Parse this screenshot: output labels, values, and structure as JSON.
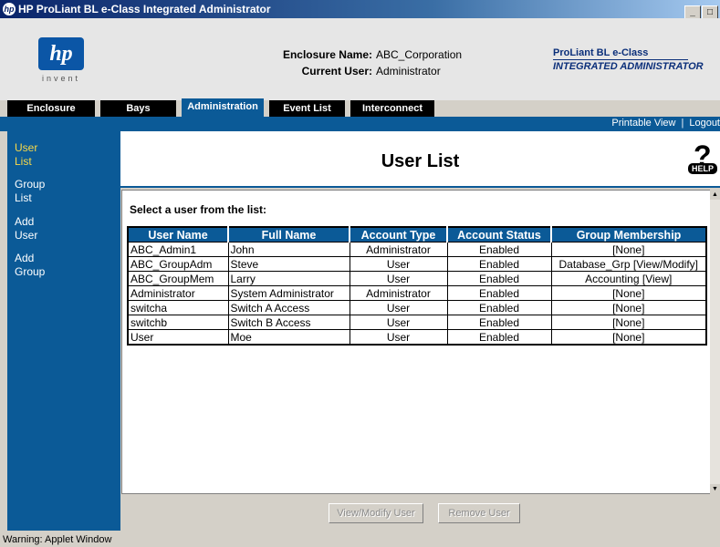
{
  "window": {
    "title": "HP ProLiant BL e-Class Integrated Administrator",
    "app_icon": "hp-logo-icon"
  },
  "header": {
    "logo_text": "invent",
    "enclosure_name_label": "Enclosure Name:",
    "enclosure_name": "ABC_Corporation",
    "current_user_label": "Current User:",
    "current_user": "Administrator",
    "brand_line1": "ProLiant BL e-Class",
    "brand_line2": "INTEGRATED ADMINISTRATOR"
  },
  "tabs": [
    "Enclosure",
    "Bays",
    "Administration",
    "Event List",
    "Interconnect"
  ],
  "active_tab": "Administration",
  "toplinks": {
    "printable": "Printable View",
    "separator": "|",
    "logout": "Logout"
  },
  "sidebar": [
    {
      "line1": "User",
      "line2": "List",
      "active": true
    },
    {
      "line1": "Group",
      "line2": "List",
      "active": false
    },
    {
      "line1": "Add",
      "line2": "User",
      "active": false
    },
    {
      "line1": "Add",
      "line2": "Group",
      "active": false
    }
  ],
  "page": {
    "title": "User List",
    "help_label": "HELP",
    "prompt": "Select a user from the list:"
  },
  "table": {
    "headers": [
      "User Name",
      "Full Name",
      "Account Type",
      "Account Status",
      "Group Membership"
    ],
    "rows": [
      [
        "ABC_Admin1",
        "John",
        "Administrator",
        "Enabled",
        "[None]"
      ],
      [
        "ABC_GroupAdm",
        "Steve",
        "User",
        "Enabled",
        "Database_Grp [View/Modify]"
      ],
      [
        "ABC_GroupMem",
        "Larry",
        "User",
        "Enabled",
        "Accounting [View]"
      ],
      [
        "Administrator",
        "System Administrator",
        "Administrator",
        "Enabled",
        "[None]"
      ],
      [
        "switcha",
        "Switch A Access",
        "User",
        "Enabled",
        "[None]"
      ],
      [
        "switchb",
        "Switch B Access",
        "User",
        "Enabled",
        "[None]"
      ],
      [
        "User",
        "Moe",
        "User",
        "Enabled",
        "[None]"
      ]
    ]
  },
  "buttons": {
    "view_modify": "View/Modify User",
    "remove": "Remove User"
  },
  "status": {
    "text": "Warning: Applet Window"
  },
  "colors": {
    "accent": "#0b5a97",
    "active_nav": "#f7d84a",
    "tab_bg": "#000000"
  }
}
